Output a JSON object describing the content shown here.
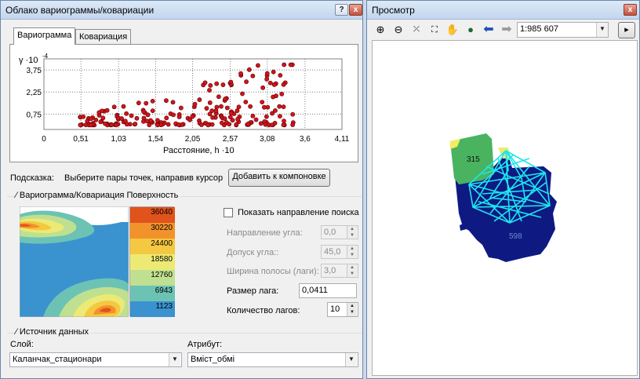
{
  "left_window": {
    "title": "Облако вариограммы/ковариации",
    "help_btn": "?",
    "close_btn": "x",
    "tabs": [
      {
        "label": "Вариограмма"
      },
      {
        "label": "Ковариация"
      }
    ]
  },
  "chart_data": {
    "type": "scatter",
    "ylabel": "γ ·10",
    "y_exponent": "-4",
    "xlabel": "Расстояние, h ·10",
    "x_ticks": [
      "0",
      "0,51",
      "1,03",
      "1,54",
      "2,05",
      "2,57",
      "3,08",
      "3,6",
      "4,11"
    ],
    "y_ticks": [
      "0,75",
      "2,25",
      "3,75"
    ],
    "xlim": [
      0,
      4.11
    ],
    "ylim": [
      -0.3,
      4.5
    ],
    "grid": true,
    "point_color": "#d2141c"
  },
  "hint": {
    "label": "Подсказка:",
    "text": "Выберите пары точек, направив курсор",
    "add_button": "Добавить к компоновке"
  },
  "surface": {
    "group_title": "Вариограмма/Ковариация Поверхность",
    "legend": [
      {
        "value": "36040",
        "color": "#e0531c"
      },
      {
        "value": "30220",
        "color": "#f2922a"
      },
      {
        "value": "24400",
        "color": "#f5c842"
      },
      {
        "value": "18580",
        "color": "#ecea74"
      },
      {
        "value": "12760",
        "color": "#bfe090"
      },
      {
        "value": "6943",
        "color": "#6cc3b4"
      },
      {
        "value": "1123",
        "color": "#3a92cf"
      }
    ]
  },
  "search": {
    "show_direction_label": "Показать направление поиска",
    "angle_direction_label": "Направление угла:",
    "angle_direction_value": "0,0",
    "angle_tolerance_label": "Допуск угла::",
    "angle_tolerance_value": "45,0",
    "bandwidth_label": "Ширина полосы (лаги):",
    "bandwidth_value": "3,0",
    "lag_size_label": "Размер лага:",
    "lag_size_value": "0,0411",
    "lag_count_label": "Количество лагов:",
    "lag_count_value": "10"
  },
  "source": {
    "group_title": "Источник данных",
    "layer_label": "Слой:",
    "layer_value": "Каланчак_стационари",
    "attribute_label": "Атрибут:",
    "attribute_value": "Вміст_обмі"
  },
  "right_window": {
    "title": "Просмотр",
    "close_btn": "x",
    "scale_value": "1:985 607",
    "map_labels": [
      "315",
      "598"
    ]
  },
  "colors": {
    "map_dark": "#0e1a82",
    "map_green": "#49b35f",
    "map_cyan": "#1de6ef",
    "map_yellow": "#f3ec5c"
  }
}
